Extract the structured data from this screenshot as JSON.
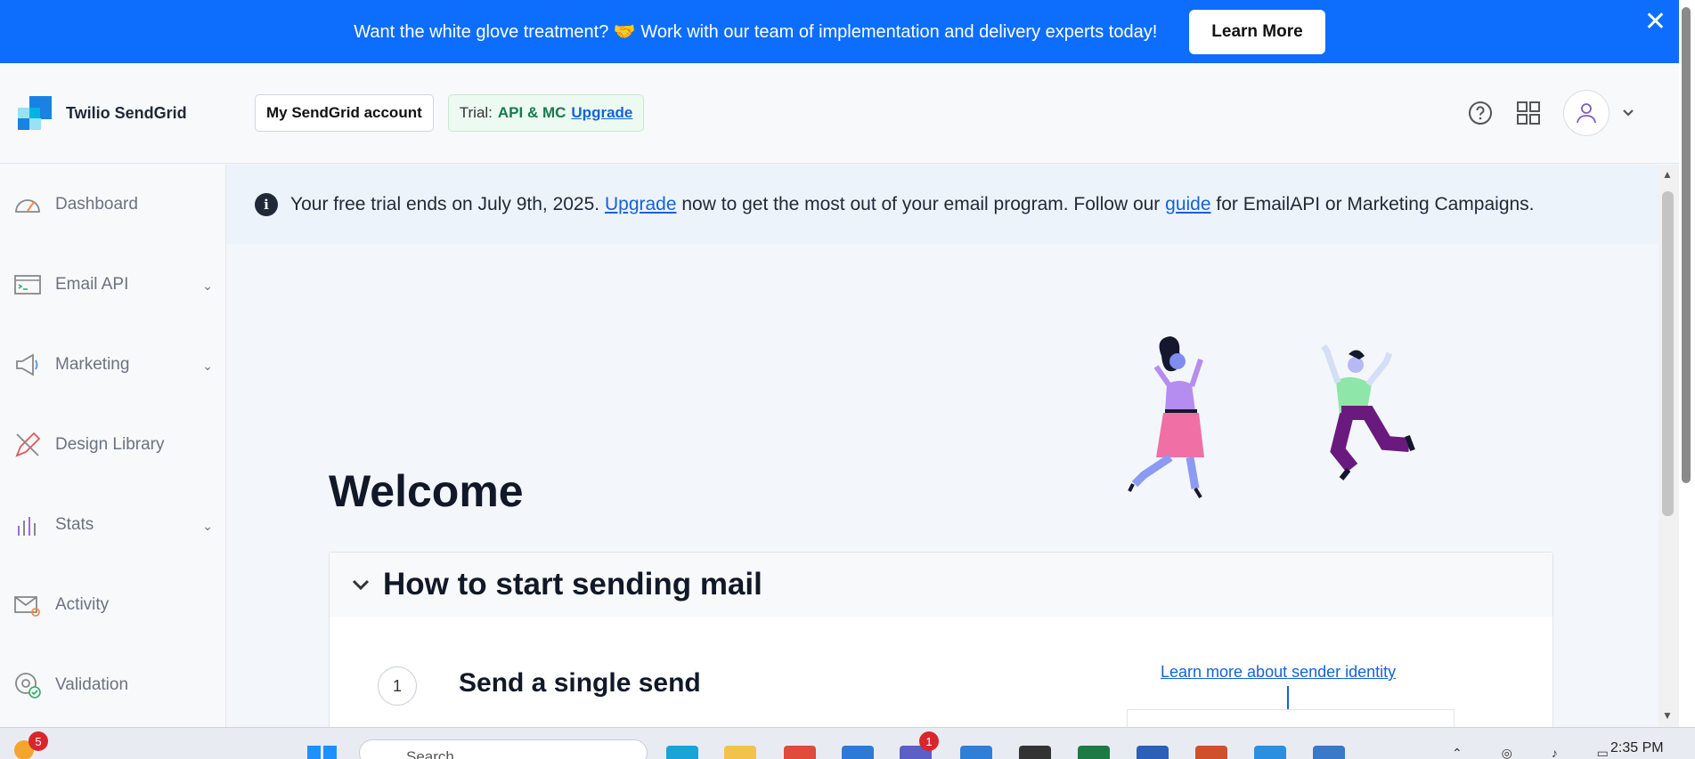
{
  "banner": {
    "text": "Want the white glove treatment? 🤝 Work with our team of implementation and delivery experts today!",
    "button_label": "Learn More",
    "close_glyph": "✕",
    "bg_color": "#0d6efd"
  },
  "header": {
    "logo_text": "Twilio SendGrid",
    "account_button": "My SendGrid account",
    "trial_label": "Trial:",
    "trial_plan": "API & MC",
    "trial_upgrade": "Upgrade",
    "icons": [
      "help-icon",
      "apps-grid-icon",
      "user-avatar-icon",
      "chevron-down-icon"
    ]
  },
  "sidebar": {
    "items": [
      {
        "label": "Dashboard",
        "icon": "speedometer-icon",
        "expandable": false
      },
      {
        "label": "Email API",
        "icon": "terminal-window-icon",
        "expandable": true
      },
      {
        "label": "Marketing",
        "icon": "megaphone-icon",
        "expandable": true
      },
      {
        "label": "Design Library",
        "icon": "pencil-ruler-icon",
        "expandable": false
      },
      {
        "label": "Stats",
        "icon": "bar-chart-icon",
        "expandable": true
      },
      {
        "label": "Activity",
        "icon": "envelope-search-icon",
        "expandable": false
      },
      {
        "label": "Validation",
        "icon": "at-check-icon",
        "expandable": false
      }
    ]
  },
  "notice": {
    "text_before": "Your free trial ends on July 9th, 2025.",
    "upgrade_link": "Upgrade",
    "text_middle": "now to get the most out of your email program. Follow our",
    "guide_link": "guide",
    "text_after": "for EmailAPI or Marketing Campaigns."
  },
  "main": {
    "welcome": "Welcome",
    "panel_title": "How to start sending mail",
    "step_number": "1",
    "step_title": "Send a single send",
    "learn_more_link": "Learn more about sender identity"
  },
  "taskbar": {
    "weather_badge": "5",
    "search_placeholder": "Search",
    "teams_badge": "1",
    "clock": "2:35 PM"
  },
  "colors": {
    "accent": "#1463d8",
    "trial_green": "#18794e",
    "logo_blue": "#1a82e2",
    "logo_light": "#99e1f4"
  }
}
